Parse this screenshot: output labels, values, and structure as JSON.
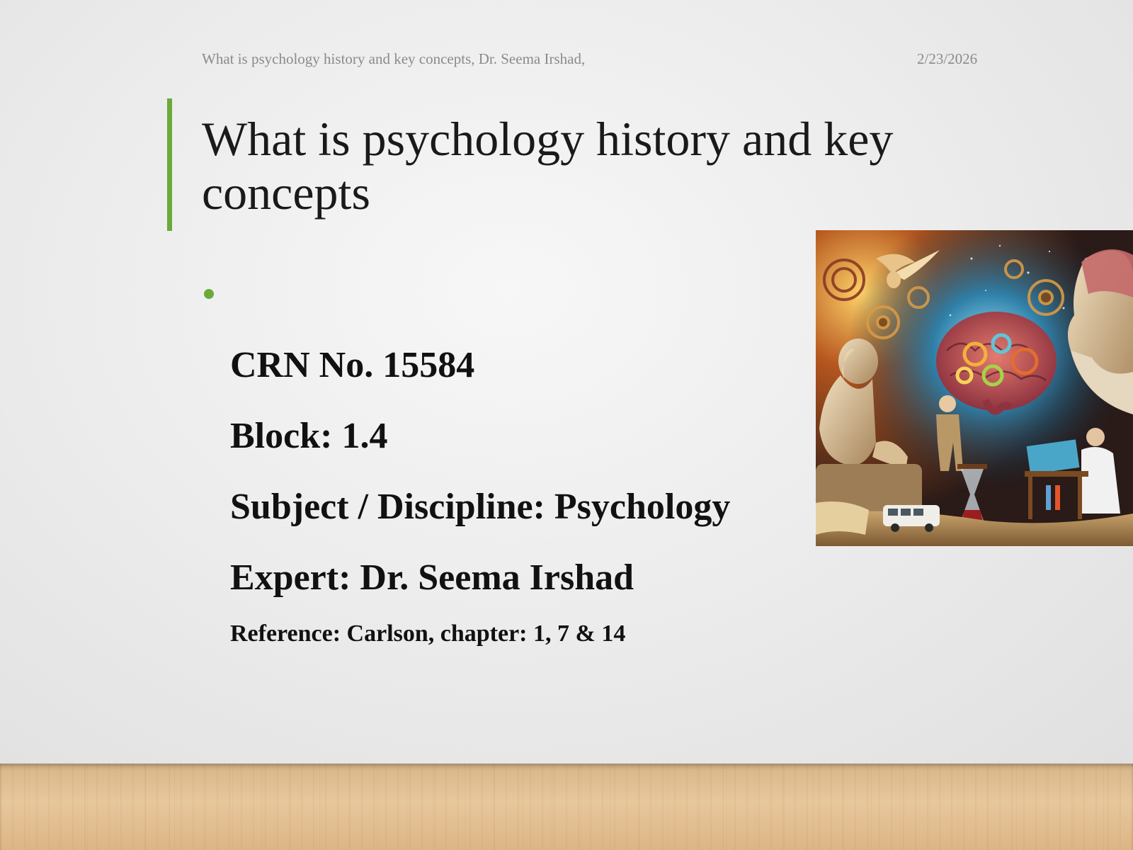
{
  "header": {
    "left_text": "What is psychology history and key concepts, Dr. Seema Irshad,",
    "date": "2/23/2026"
  },
  "title": "What is psychology history and key concepts",
  "details": {
    "crn": "CRN No. 15584",
    "block": "Block: 1.4",
    "subject": "Subject / Discipline: Psychology",
    "expert": "Expert: Dr. Seema Irshad",
    "reference": "Reference: Carlson, chapter: 1, 7 & 14"
  },
  "colors": {
    "accent": "#6aaa3a"
  },
  "illustration": {
    "icon": "psychology-history-illustration"
  }
}
